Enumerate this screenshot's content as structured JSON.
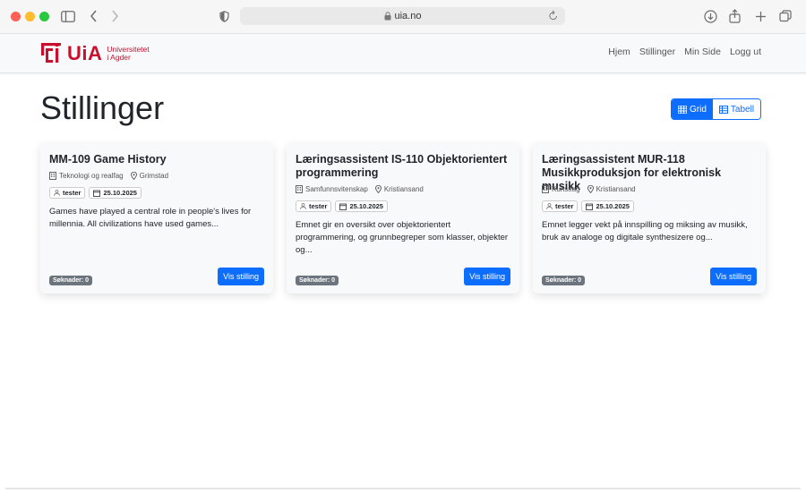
{
  "browser": {
    "url": "uia.no"
  },
  "brand": {
    "name": "UiA",
    "sub_line1": "Universitetet",
    "sub_line2": "i Agder",
    "color": "#c8102e"
  },
  "nav": {
    "items": [
      {
        "label": "Hjem"
      },
      {
        "label": "Stillinger"
      },
      {
        "label": "Min Side"
      },
      {
        "label": "Logg ut"
      }
    ]
  },
  "page": {
    "title": "Stillinger"
  },
  "view_toggle": {
    "grid_label": "Grid",
    "table_label": "Tabell",
    "active": "grid"
  },
  "cards": [
    {
      "title": "MM-109 Game History",
      "faculty": "Teknologi og realfag",
      "location": "Grimstad",
      "author": "tester",
      "date": "25.10.2025",
      "description": "Games have played a central role in people's lives for millennia. All civilizations have used games...",
      "applications": "Søknader: 0",
      "button": "Vis stilling"
    },
    {
      "title": "Læringsassistent IS-110 Objektorientert programmering",
      "faculty": "Samfunnsvitenskap",
      "location": "Kristiansand",
      "author": "tester",
      "date": "25.10.2025",
      "description": "Emnet gir en oversikt over objektorientert programmering, og grunnbegreper som klasser, objekter og...",
      "applications": "Søknader: 0",
      "button": "Vis stilling"
    },
    {
      "title": "Læringsassistent MUR-118 Musikkproduksjon for elektronisk musikk",
      "faculty": "Kunstfag",
      "location": "Kristiansand",
      "author": "tester",
      "date": "25.10.2025",
      "description": "Emnet legger vekt på innspilling og miksing av musikk, bruk av analoge og digitale synthesizere og...",
      "applications": "Søknader: 0",
      "button": "Vis stilling"
    }
  ]
}
